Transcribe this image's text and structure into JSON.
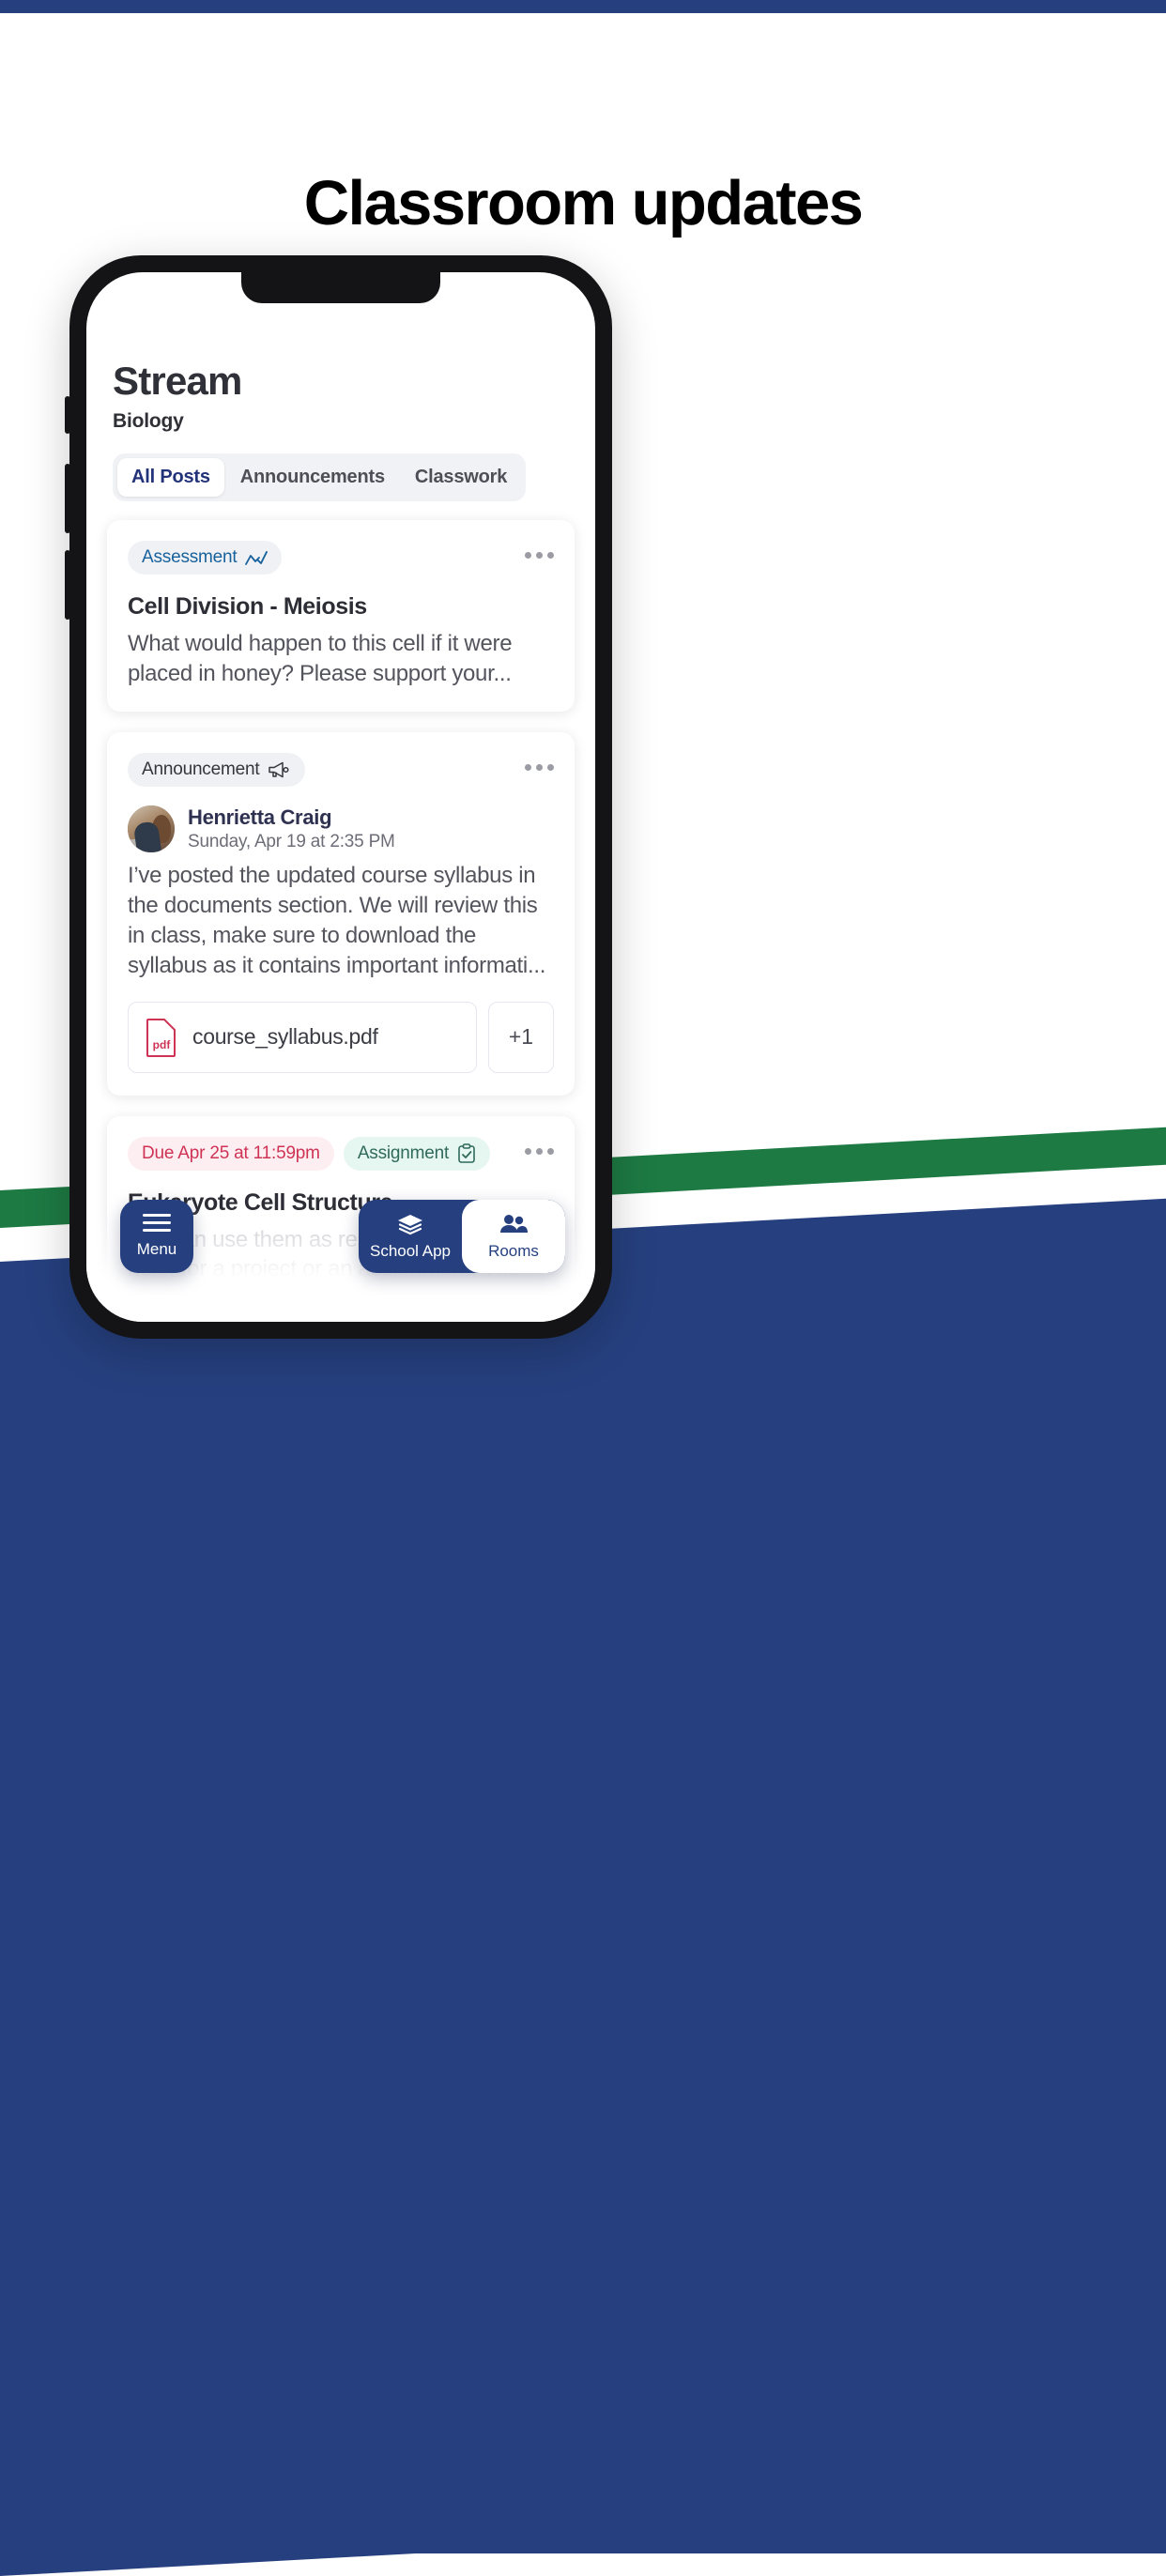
{
  "page": {
    "title": "Classroom updates",
    "accent_navy": "#26407f",
    "accent_green": "#1d7a43"
  },
  "app": {
    "header": {
      "title": "Stream",
      "subtitle": "Biology"
    },
    "tabs": [
      {
        "label": "All Posts",
        "active": true
      },
      {
        "label": "Announcements",
        "active": false
      },
      {
        "label": "Classwork",
        "active": false
      }
    ],
    "posts": [
      {
        "badge": {
          "label": "Assessment",
          "icon": "analytics-chart-icon",
          "color": "#17619c"
        },
        "title": "Cell Division - Meiosis",
        "body": "What would happen to this cell if it were placed in honey? Please support your...",
        "menu": "more-options"
      },
      {
        "badge": {
          "label": "Announcement",
          "icon": "megaphone-icon",
          "color": "#35353d"
        },
        "author": {
          "name": "Henrietta Craig",
          "timestamp": "Sunday, Apr 19 at 2:35 PM"
        },
        "body": "I’ve posted the updated course syllabus in the documents section. We will review this in class, make sure to download the syllabus as it contains important informati...",
        "attachments": [
          {
            "name": "course_syllabus.pdf",
            "type": "pdf",
            "icon_label": "pdf"
          }
        ],
        "attachments_more": "+1",
        "menu": "more-options"
      },
      {
        "due_badge": {
          "label": "Due Apr 25 at 11:59pm",
          "color": "#cf3355"
        },
        "badge": {
          "label": "Assignment",
          "icon": "clipboard-check-icon",
          "color": "#2f6a5a"
        },
        "title": "Eukaryote Cell Structure",
        "body": "You can use them as resources to go to for help, for a project or an assignment. The",
        "menu": "more-options"
      }
    ],
    "bottom_nav": {
      "menu": {
        "label": "Menu",
        "icon": "hamburger-icon"
      },
      "items": [
        {
          "label": "School App",
          "icon": "layers-icon",
          "active": false
        },
        {
          "label": "Rooms",
          "icon": "people-icon",
          "active": true
        }
      ]
    }
  }
}
